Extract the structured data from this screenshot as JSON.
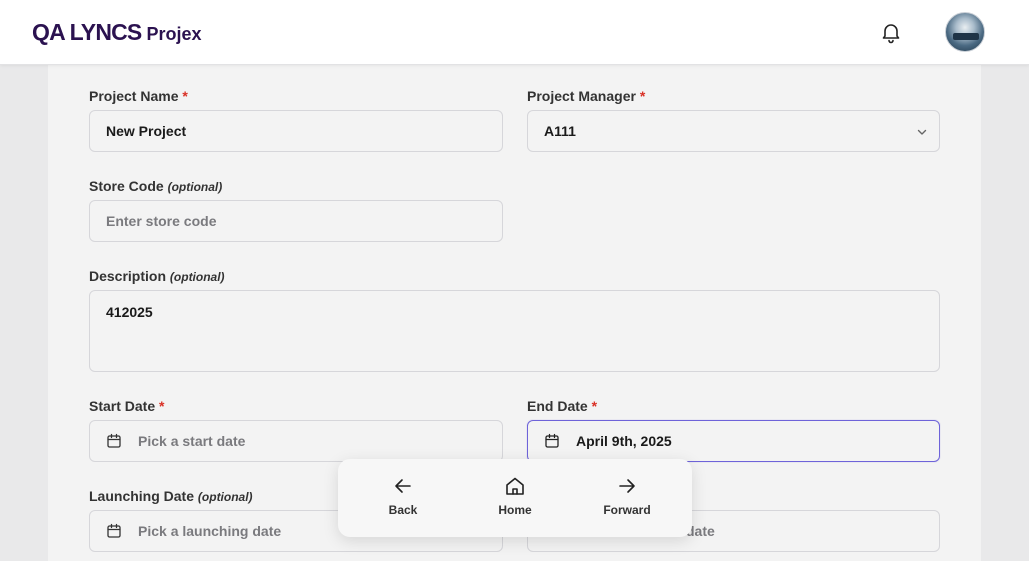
{
  "header": {
    "brand_main": "QA LYNCS",
    "brand_sub": "Projex",
    "notifications_icon": "bell-icon",
    "avatar_icon": "user-avatar"
  },
  "form": {
    "project_name": {
      "label": "Project Name",
      "required": "*",
      "value": "New Project"
    },
    "project_manager": {
      "label": "Project Manager",
      "required": "*",
      "value": "A111"
    },
    "store_code": {
      "label": "Store Code",
      "optional": "(optional)",
      "placeholder": "Enter store code"
    },
    "description": {
      "label": "Description",
      "optional": "(optional)",
      "value": "412025"
    },
    "start_date": {
      "label": "Start Date",
      "required": "*",
      "placeholder": "Pick a start date"
    },
    "end_date": {
      "label": "End Date",
      "required": "*",
      "value": "April 9th, 2025"
    },
    "launching_date": {
      "label": "Launching Date",
      "optional": "(optional)",
      "placeholder": "Pick a launching date"
    },
    "hidden_date": {
      "placeholder_partial": "date"
    }
  },
  "nav_popup": {
    "back": "Back",
    "home": "Home",
    "forward": "Forward"
  },
  "colors": {
    "brand": "#2b1250",
    "required": "#d93025",
    "focus_border": "#6e63d9"
  }
}
